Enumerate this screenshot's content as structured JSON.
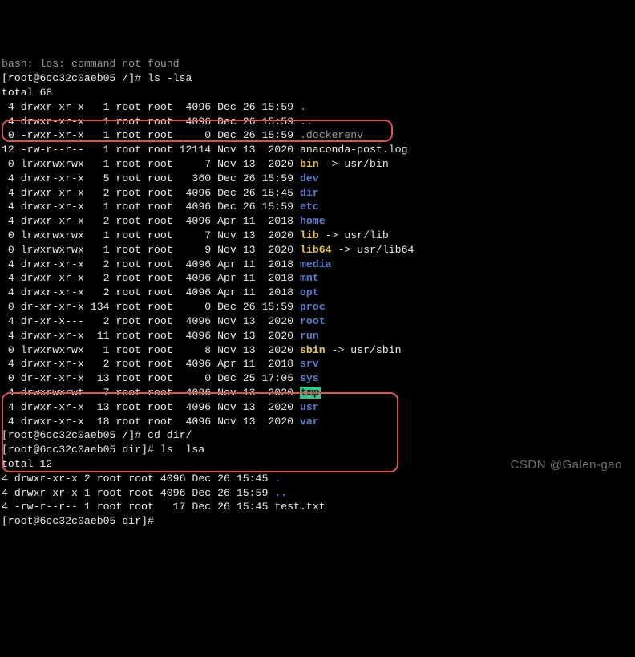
{
  "errline": "bash: lds: command not found",
  "host": "6cc32c0aeb05",
  "prompt1": "[root@6cc32c0aeb05 /]#",
  "prompt_dir": "[root@6cc32c0aeb05 dir]#",
  "cmd1": "ls -lsa",
  "cmd2": "cd dir/",
  "cmd3": "ls  lsa",
  "total1": "total 68",
  "total2": "total 12",
  "watermark": "CSDN @Galen-gao",
  "rows1": [
    {
      "b": " 4",
      "p": "drwxr-xr-x",
      "l": "   1",
      "u": "root",
      "g": "root",
      "s": "  4096",
      "d": "Dec 26 15:59",
      "n": ".",
      "c": "blue"
    },
    {
      "b": " 4",
      "p": "drwxr-xr-x",
      "l": "   1",
      "u": "root",
      "g": "root",
      "s": "  4096",
      "d": "Dec 26 15:59",
      "n": "..",
      "c": "blue"
    },
    {
      "b": " 0",
      "p": "-rwxr-xr-x",
      "l": "   1",
      "u": "root",
      "g": "root",
      "s": "     0",
      "d": "Dec 26 15:59",
      "n": ".dockerenv",
      "c": "gray"
    },
    {
      "b": "12",
      "p": "-rw-r--r--",
      "l": "   1",
      "u": "root",
      "g": "root",
      "s": " 12114",
      "d": "Nov 13  2020",
      "n": "anaconda-post.log",
      "c": "white"
    },
    {
      "b": " 0",
      "p": "lrwxrwxrwx",
      "l": "   1",
      "u": "root",
      "g": "root",
      "s": "     7",
      "d": "Nov 13  2020",
      "n": "bin",
      "c": "yellow",
      "arrow": " -> usr/bin"
    },
    {
      "b": " 4",
      "p": "drwxr-xr-x",
      "l": "   5",
      "u": "root",
      "g": "root",
      "s": "   360",
      "d": "Dec 26 15:59",
      "n": "dev",
      "c": "blue"
    },
    {
      "b": " 4",
      "p": "drwxr-xr-x",
      "l": "   2",
      "u": "root",
      "g": "root",
      "s": "  4096",
      "d": "Dec 26 15:45",
      "n": "dir",
      "c": "blue"
    },
    {
      "b": " 4",
      "p": "drwxr-xr-x",
      "l": "   1",
      "u": "root",
      "g": "root",
      "s": "  4096",
      "d": "Dec 26 15:59",
      "n": "etc",
      "c": "blue"
    },
    {
      "b": " 4",
      "p": "drwxr-xr-x",
      "l": "   2",
      "u": "root",
      "g": "root",
      "s": "  4096",
      "d": "Apr 11  2018",
      "n": "home",
      "c": "blue"
    },
    {
      "b": " 0",
      "p": "lrwxrwxrwx",
      "l": "   1",
      "u": "root",
      "g": "root",
      "s": "     7",
      "d": "Nov 13  2020",
      "n": "lib",
      "c": "yellow",
      "arrow": " -> usr/lib"
    },
    {
      "b": " 0",
      "p": "lrwxrwxrwx",
      "l": "   1",
      "u": "root",
      "g": "root",
      "s": "     9",
      "d": "Nov 13  2020",
      "n": "lib64",
      "c": "yellow",
      "arrow": " -> usr/lib64"
    },
    {
      "b": " 4",
      "p": "drwxr-xr-x",
      "l": "   2",
      "u": "root",
      "g": "root",
      "s": "  4096",
      "d": "Apr 11  2018",
      "n": "media",
      "c": "blue"
    },
    {
      "b": " 4",
      "p": "drwxr-xr-x",
      "l": "   2",
      "u": "root",
      "g": "root",
      "s": "  4096",
      "d": "Apr 11  2018",
      "n": "mnt",
      "c": "blue"
    },
    {
      "b": " 4",
      "p": "drwxr-xr-x",
      "l": "   2",
      "u": "root",
      "g": "root",
      "s": "  4096",
      "d": "Apr 11  2018",
      "n": "opt",
      "c": "blue"
    },
    {
      "b": " 0",
      "p": "dr-xr-xr-x",
      "l": " 134",
      "u": "root",
      "g": "root",
      "s": "     0",
      "d": "Dec 26 15:59",
      "n": "proc",
      "c": "blue"
    },
    {
      "b": " 4",
      "p": "dr-xr-x---",
      "l": "   2",
      "u": "root",
      "g": "root",
      "s": "  4096",
      "d": "Nov 13  2020",
      "n": "root",
      "c": "blue"
    },
    {
      "b": " 4",
      "p": "drwxr-xr-x",
      "l": "  11",
      "u": "root",
      "g": "root",
      "s": "  4096",
      "d": "Nov 13  2020",
      "n": "run",
      "c": "blue"
    },
    {
      "b": " 0",
      "p": "lrwxrwxrwx",
      "l": "   1",
      "u": "root",
      "g": "root",
      "s": "     8",
      "d": "Nov 13  2020",
      "n": "sbin",
      "c": "yellow",
      "arrow": " -> usr/sbin"
    },
    {
      "b": " 4",
      "p": "drwxr-xr-x",
      "l": "   2",
      "u": "root",
      "g": "root",
      "s": "  4096",
      "d": "Apr 11  2018",
      "n": "srv",
      "c": "blue"
    },
    {
      "b": " 0",
      "p": "dr-xr-xr-x",
      "l": "  13",
      "u": "root",
      "g": "root",
      "s": "     0",
      "d": "Dec 25 17:05",
      "n": "sys",
      "c": "blue"
    },
    {
      "b": " 4",
      "p": "drwxrwxrwt",
      "l": "   7",
      "u": "root",
      "g": "root",
      "s": "  4096",
      "d": "Nov 13  2020",
      "n": "tmp",
      "c": "tmp"
    },
    {
      "b": " 4",
      "p": "drwxr-xr-x",
      "l": "  13",
      "u": "root",
      "g": "root",
      "s": "  4096",
      "d": "Nov 13  2020",
      "n": "usr",
      "c": "blue"
    },
    {
      "b": " 4",
      "p": "drwxr-xr-x",
      "l": "  18",
      "u": "root",
      "g": "root",
      "s": "  4096",
      "d": "Nov 13  2020",
      "n": "var",
      "c": "blue"
    }
  ],
  "rows2": [
    {
      "b": "4",
      "p": "drwxr-xr-x",
      "l": "2",
      "u": "root",
      "g": "root",
      "s": "4096",
      "d": "Dec 26 15:45",
      "n": ".",
      "c": "blue"
    },
    {
      "b": "4",
      "p": "drwxr-xr-x",
      "l": "1",
      "u": "root",
      "g": "root",
      "s": "4096",
      "d": "Dec 26 15:59",
      "n": "..",
      "c": "blue"
    },
    {
      "b": "4",
      "p": "-rw-r--r--",
      "l": "1",
      "u": "root",
      "g": "root",
      "s": "  17",
      "d": "Dec 26 15:45",
      "n": "test.txt",
      "c": "white"
    }
  ]
}
